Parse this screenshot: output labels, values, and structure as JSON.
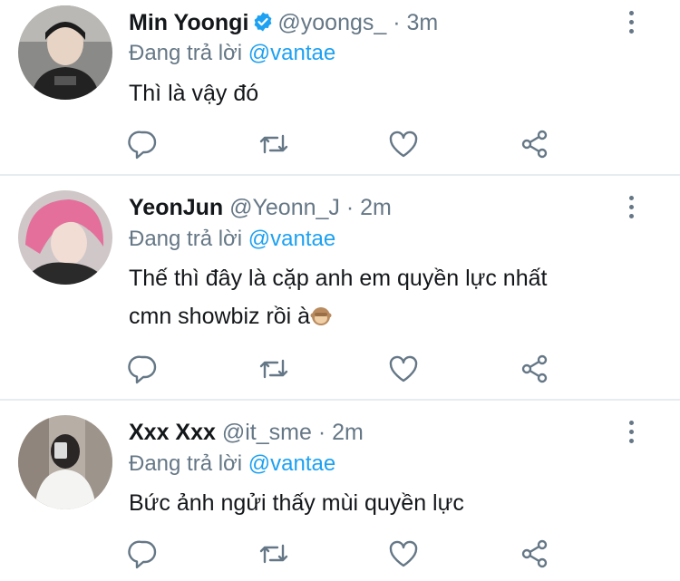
{
  "tweets": [
    {
      "name": "Min Yoongi",
      "verified": true,
      "handle": "@yoongs_",
      "dot": "·",
      "time": "3m",
      "replying_label": "Đang trả lời",
      "replying_to": "@vantae",
      "text": " Thì là vậy đó"
    },
    {
      "name": "YeonJun",
      "verified": false,
      "handle": "@Yeonn_J",
      "dot": "·",
      "time": "2m",
      "replying_label": "Đang trả lời",
      "replying_to": "@vantae",
      "text_line1": "Thế thì đây là cặp anh em quyền lực nhất",
      "text_line2": "cmn showbiz rồi à",
      "emoji": "see-no-evil-monkey"
    },
    {
      "name": "Xxx Xxx",
      "verified": false,
      "handle": "@it_sme",
      "dot": "·",
      "time": "2m",
      "replying_label": "Đang trả lời",
      "replying_to": "@vantae",
      "text": "Bức ảnh ngửi thấy mùi quyền lực"
    }
  ],
  "icons": {
    "reply": "reply-icon",
    "retweet": "retweet-icon",
    "like": "heart-icon",
    "share": "share-icon",
    "more": "more-vertical-icon",
    "verified": "verified-badge-icon"
  },
  "colors": {
    "accent": "#1da1f2",
    "secondary_text": "#657786",
    "primary_text": "#14171a",
    "divider": "#e6ecf0"
  }
}
